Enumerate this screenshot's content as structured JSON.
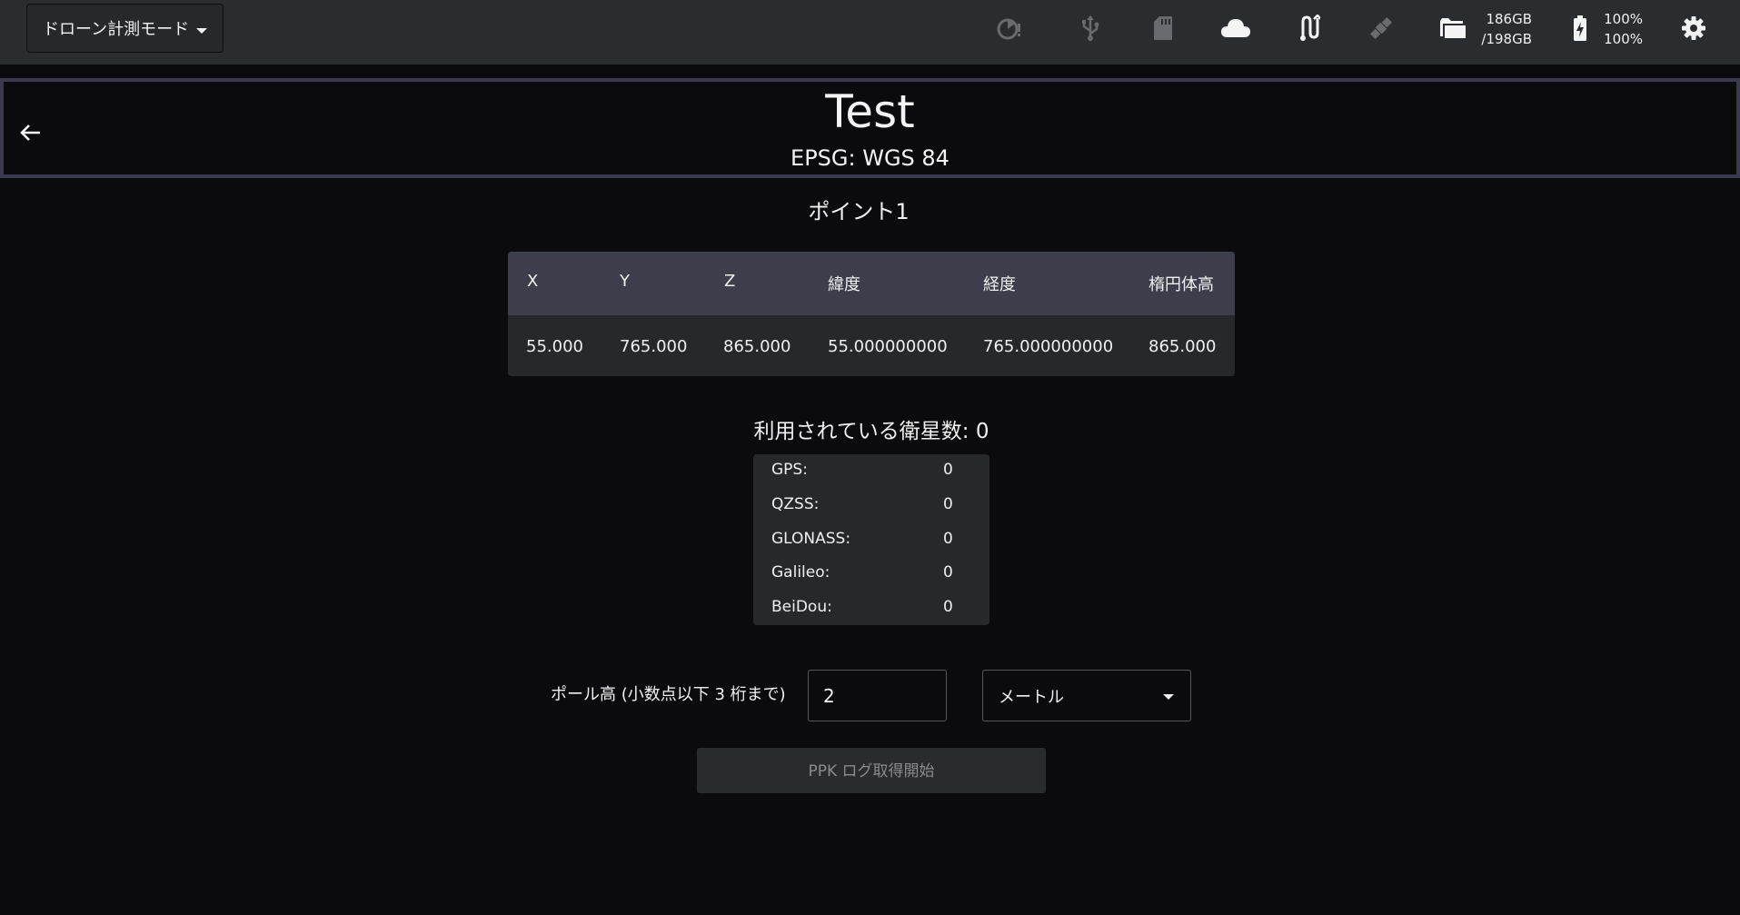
{
  "topbar": {
    "mode_label": "ドローン計測モード",
    "icons": [
      "timer-alert-icon",
      "usb-icon",
      "sd-card-icon",
      "cloud-icon",
      "antenna-icon",
      "satellite-icon",
      "folder-icon",
      "battery-charging-icon",
      "gear-icon"
    ],
    "storage_used": "186GB",
    "storage_total": "/198GB",
    "battery_1": "100%",
    "battery_2": "100%"
  },
  "header": {
    "title": "Test",
    "subtitle": "EPSG: WGS 84"
  },
  "point": {
    "name": "ポイント1"
  },
  "coords": {
    "headers": [
      "X",
      "Y",
      "Z",
      "緯度",
      "経度",
      "楕円体高"
    ],
    "values": [
      "55.000",
      "765.000",
      "865.000",
      "55.000000000",
      "765.000000000",
      "865.000"
    ]
  },
  "satellites": {
    "title": "利用されている衛星数: 0",
    "rows": [
      {
        "label": "GPS:",
        "value": "0"
      },
      {
        "label": "QZSS:",
        "value": "0"
      },
      {
        "label": "GLONASS:",
        "value": "0"
      },
      {
        "label": "Galileo:",
        "value": "0"
      },
      {
        "label": "BeiDou:",
        "value": "0"
      }
    ]
  },
  "pole": {
    "label": "ポール高 (小数点以下 3 桁まで)",
    "value": "2",
    "unit": "メートル"
  },
  "ppk_button": "PPK ログ取得開始"
}
